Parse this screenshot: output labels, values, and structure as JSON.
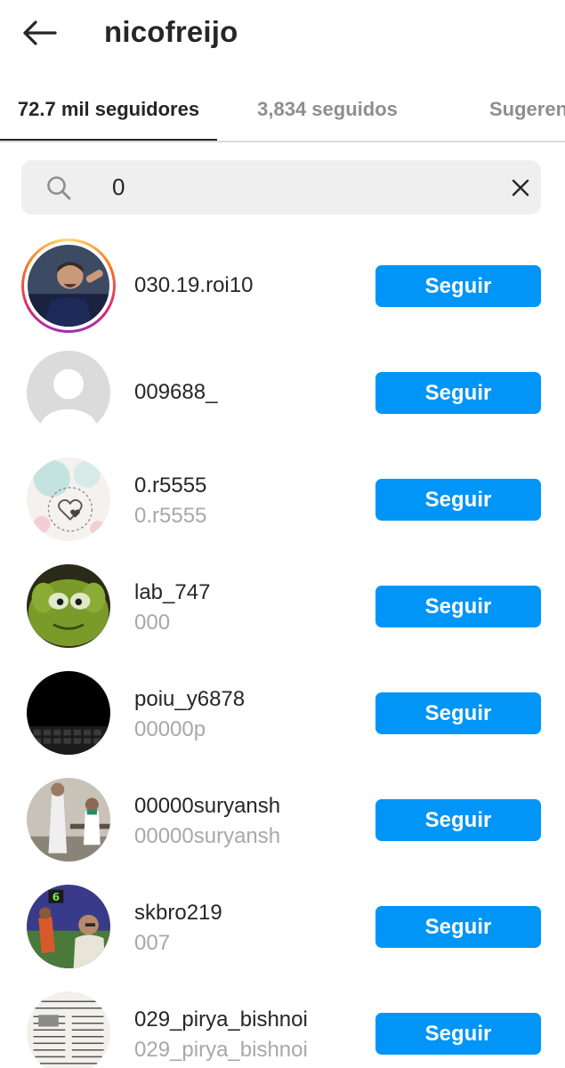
{
  "header": {
    "title": "nicofreijo",
    "back_icon": "arrow-left-icon"
  },
  "tabs": [
    {
      "label": "72.7 mil seguidores",
      "active": true
    },
    {
      "label": "3,834 seguidos",
      "active": false
    },
    {
      "label": "Sugeren",
      "active": false
    }
  ],
  "search": {
    "value": "0",
    "icon": "search-icon",
    "clear_icon": "close-icon"
  },
  "colors": {
    "follow_button": "#0095f6",
    "secondary_text": "#a8a8a8",
    "search_bg": "#efefef"
  },
  "users": [
    {
      "username": "030.19.roi10",
      "full_name": "",
      "button": "Seguir",
      "story_ring": true
    },
    {
      "username": "009688_",
      "full_name": "",
      "button": "Seguir",
      "story_ring": false
    },
    {
      "username": "0.r5555",
      "full_name": "0.r5555",
      "button": "Seguir",
      "story_ring": false
    },
    {
      "username": "lab_747",
      "full_name": "000",
      "button": "Seguir",
      "story_ring": false
    },
    {
      "username": "poiu_y6878",
      "full_name": "00000p",
      "button": "Seguir",
      "story_ring": false
    },
    {
      "username": "00000suryansh",
      "full_name": "00000suryansh",
      "button": "Seguir",
      "story_ring": false
    },
    {
      "username": "skbro219",
      "full_name": "007",
      "button": "Seguir",
      "story_ring": false
    },
    {
      "username": "029_pirya_bishnoi",
      "full_name": "029_pirya_bishnoi",
      "button": "Seguir",
      "story_ring": false
    }
  ]
}
